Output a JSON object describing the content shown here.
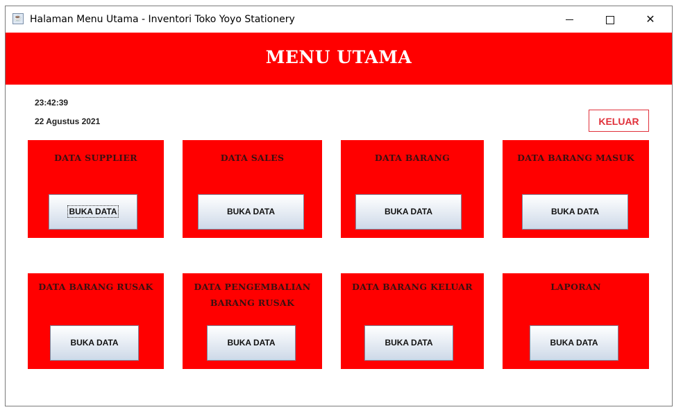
{
  "window": {
    "title": "Halaman Menu Utama - Inventori Toko Yoyo Stationery",
    "icon": "java-cup-icon",
    "controls": {
      "minimize": "minimize-icon",
      "maximize": "maximize-icon",
      "close": "✕"
    }
  },
  "header": {
    "title": "MENU UTAMA"
  },
  "status": {
    "time": "23:42:39",
    "date": "22 Agustus 2021"
  },
  "logout_label": "KELUAR",
  "colors": {
    "accent": "#ff0000",
    "logout_border": "#e0303a"
  },
  "cards": [
    {
      "title": "DATA SUPPLIER",
      "button": "BUKA DATA"
    },
    {
      "title": "DATA SALES",
      "button": "BUKA DATA"
    },
    {
      "title": "DATA BARANG",
      "button": "BUKA DATA"
    },
    {
      "title": "DATA BARANG MASUK",
      "button": "BUKA DATA"
    },
    {
      "title": "DATA BARANG RUSAK",
      "button": "BUKA DATA"
    },
    {
      "title": "DATA PENGEMBALIAN BARANG RUSAK",
      "button": "BUKA DATA"
    },
    {
      "title": "DATA BARANG KELUAR",
      "button": "BUKA DATA"
    },
    {
      "title": "LAPORAN",
      "button": "BUKA DATA"
    }
  ]
}
